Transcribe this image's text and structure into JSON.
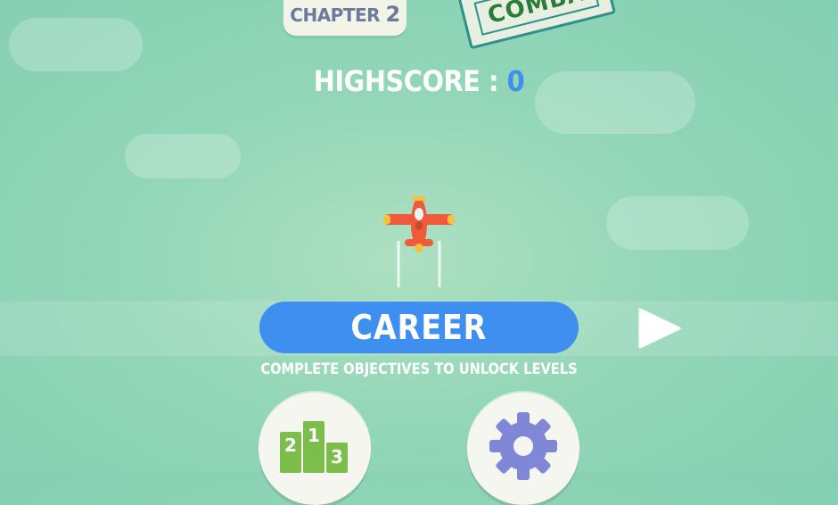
{
  "header": {
    "chapter_word": "CHAPTER",
    "chapter_number": "2",
    "stamp_label": "COMBA"
  },
  "score": {
    "label": "HIGHSCORE : ",
    "value": "0"
  },
  "main": {
    "mode_label": "CAREER",
    "subtitle": "COMPLETE OBJECTIVES TO UNLOCK LEVELS"
  },
  "leaderboard": {
    "first": "1",
    "second": "2",
    "third": "3"
  },
  "icons": {
    "plane": "plane-icon",
    "next": "play-triangle-icon",
    "leaderboard": "podium-icon",
    "settings": "gear-icon"
  },
  "colors": {
    "background": "#93d6b8",
    "accent_blue": "#3f8ff0",
    "plane_red": "#ee5a3a",
    "podium_green": "#7cbd4c",
    "gear_purple": "#7f87d6"
  }
}
